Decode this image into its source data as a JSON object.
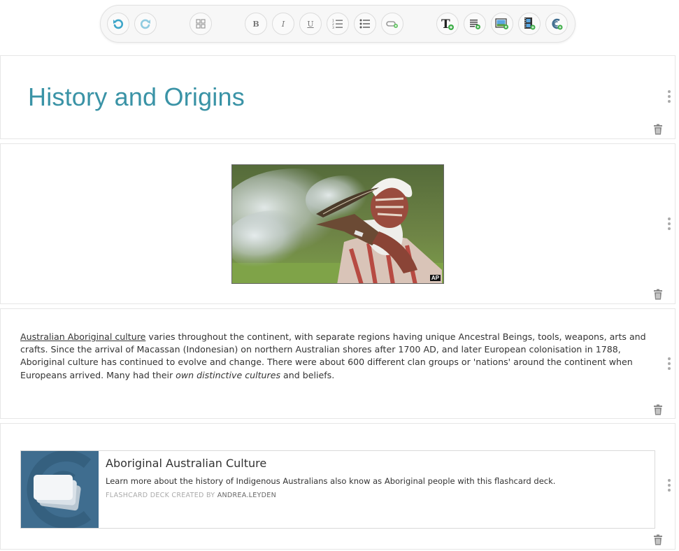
{
  "toolbar": {
    "buttons": [
      {
        "name": "undo-icon"
      },
      {
        "name": "redo-icon"
      },
      {
        "name": "layout-grid-icon"
      },
      {
        "name": "bold",
        "label": "B"
      },
      {
        "name": "italic",
        "label": "I"
      },
      {
        "name": "underline",
        "label": "U"
      },
      {
        "name": "ordered-list-icon"
      },
      {
        "name": "unordered-list-icon"
      },
      {
        "name": "link-icon"
      },
      {
        "name": "add-heading-icon"
      },
      {
        "name": "add-text-icon"
      },
      {
        "name": "add-image-icon"
      },
      {
        "name": "add-video-icon"
      },
      {
        "name": "add-deck-icon"
      }
    ],
    "accent": "#3ea6c9"
  },
  "heading_block": {
    "title": "History and Origins",
    "color": "#3a93a6"
  },
  "image_block": {
    "credit": "AP"
  },
  "text_block": {
    "link_text": "Australian Aboriginal culture",
    "text_1": " varies throughout the continent, with separate regions having unique Ancestral Beings, tools, weapons, arts and crafts. Since the arrival of Macassan (Indonesian) on northern Australian shores after 1700 AD, and later European colonisation in 1788, Aboriginal culture has continued to evolve and change. There were about 600 different clan groups or 'nations' around the continent when Europeans arrived. Many had their ",
    "emphasis": "own distinctive cultures",
    "text_2": " and beliefs."
  },
  "deck_block": {
    "title": "Aboriginal Australian Culture",
    "description": "Learn more about the history of Indigenous Australians also know as Aboriginal people with this flashcard deck.",
    "meta_prefix": "FLASHCARD DECK CREATED BY ",
    "author": "ANDREA.LEYDEN",
    "thumb_color": "#3f6d8f"
  }
}
